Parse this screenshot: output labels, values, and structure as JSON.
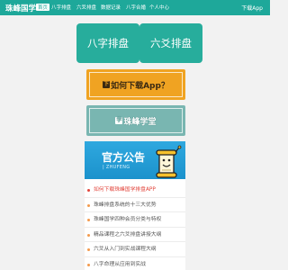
{
  "header": {
    "logo": "珠峰国学",
    "nav": [
      "首页",
      "八字排盘",
      "六爻排盘",
      "数据记录",
      "八字合婚",
      "个人中心"
    ],
    "active_index": 0,
    "download": "下载App"
  },
  "tiles": [
    {
      "label": "八字排盘"
    },
    {
      "label": "六爻排盘"
    }
  ],
  "banners": [
    {
      "icon_text": "下",
      "label": "如何下载App？"
    },
    {
      "icon_text": "学",
      "label": "珠峰学堂"
    }
  ],
  "notice": {
    "title": "官方公告",
    "subtitle": "| ZHUFENG",
    "items": [
      "如何下载珠峰国学排盘APP",
      "珠峰排盘系统的十三大优势",
      "珠峰国学四种会员分类与特权",
      "精品课程之六爻排盘讲授大纲",
      "六爻从入门到实战课程大纲",
      "八字命理从应用到实战"
    ],
    "highlight_index": 0
  },
  "colors": {
    "brand": "#1ea89a",
    "tile": "#27ad9c",
    "download_banner": "#f0a322",
    "learn_banner": "#79b6b1",
    "notice_header": "#1b92cc",
    "highlight": "#e2453c"
  },
  "icons": {
    "download_banner": "download-icon",
    "learn_banner": "school-icon",
    "notice_mascot": "scroll-mascot-icon"
  }
}
